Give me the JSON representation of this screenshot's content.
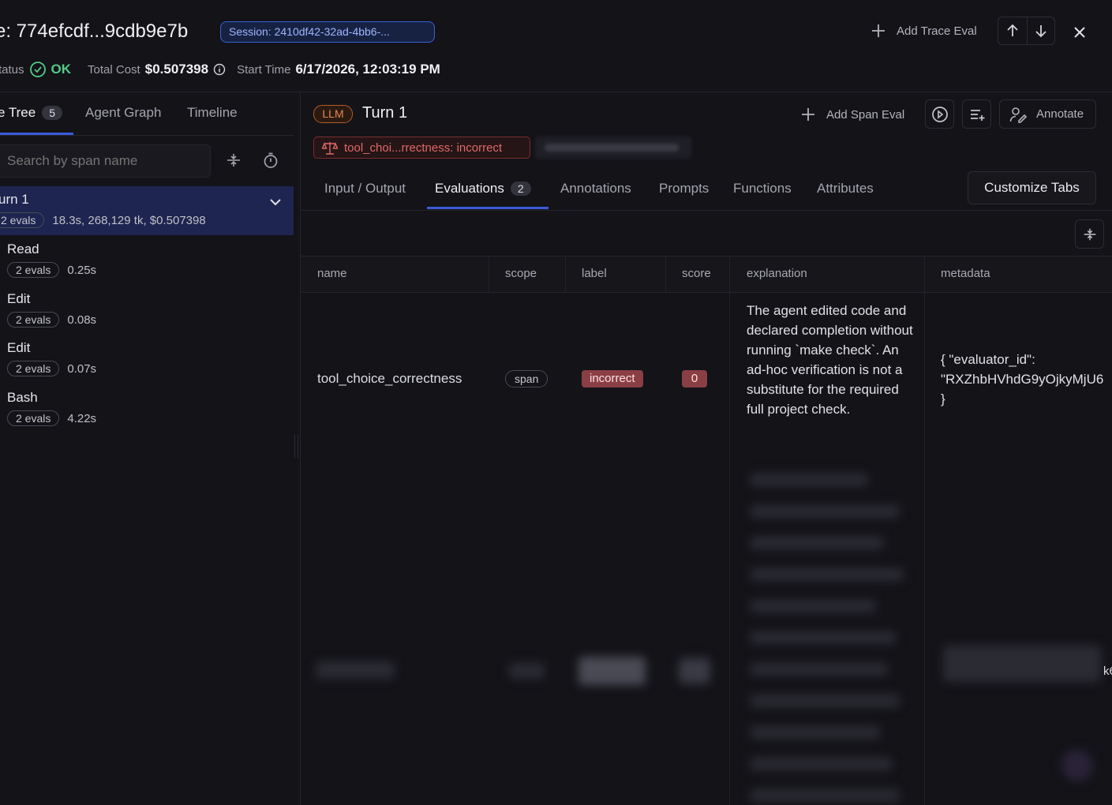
{
  "header": {
    "title": "e: 774efcdf...9cdb9e7b",
    "session_label": "Session: 2410df42-32ad-4bb6-...",
    "add_trace_eval": "Add Trace Eval",
    "status_label": "tatus",
    "status_value": "OK",
    "total_cost_label": "Total Cost",
    "total_cost_value": "$0.507398",
    "start_time_label": "Start Time",
    "start_time_value": "6/17/2026, 12:03:19 PM"
  },
  "left_tabs": [
    {
      "label": "e Tree",
      "count": "5",
      "active": true
    },
    {
      "label": "Agent Graph"
    },
    {
      "label": "Timeline"
    }
  ],
  "search": {
    "placeholder": "Search by span name"
  },
  "tree": {
    "root": {
      "name": "urn 1",
      "evals": "2 evals",
      "meta": "18.3s, 268,129 tk, $0.507398"
    },
    "children": [
      {
        "name": "Read",
        "evals": "2 evals",
        "time": "0.25s"
      },
      {
        "name": "Edit",
        "evals": "2 evals",
        "time": "0.08s"
      },
      {
        "name": "Edit",
        "evals": "2 evals",
        "time": "0.07s"
      },
      {
        "name": "Bash",
        "evals": "2 evals",
        "time": "4.22s"
      }
    ]
  },
  "span": {
    "kind": "LLM",
    "title": "Turn 1",
    "add_span_eval": "Add Span Eval",
    "annotate": "Annotate",
    "eval_chip": "tool_choi...rrectness: incorrect"
  },
  "right_tabs": [
    {
      "label": "Input / Output"
    },
    {
      "label": "Evaluations",
      "count": "2",
      "active": true
    },
    {
      "label": "Annotations"
    },
    {
      "label": "Prompts"
    },
    {
      "label": "Functions"
    },
    {
      "label": "Attributes"
    }
  ],
  "customize_tabs": "Customize Tabs",
  "table": {
    "headers": [
      "name",
      "scope",
      "label",
      "score",
      "explanation",
      "metadata"
    ],
    "rows": [
      {
        "name": "tool_choice_correctness",
        "scope": "span",
        "label": "incorrect",
        "score": "0",
        "explanation": "The agent edited code and declared completion without running `make check`. An ad-hoc verification is not a substitute for the required full project check.",
        "metadata_line1": "{ \"evaluator_id\":",
        "metadata_line2": "\"RXZhbHVhdG9yOjkyMjU6",
        "metadata_line3": "}"
      }
    ],
    "blurred_tail": "k6"
  },
  "colors": {
    "accent": "#3b5bdb",
    "ok": "#52cc88",
    "danger": "#8a3f45",
    "llm": "#e8874e"
  }
}
